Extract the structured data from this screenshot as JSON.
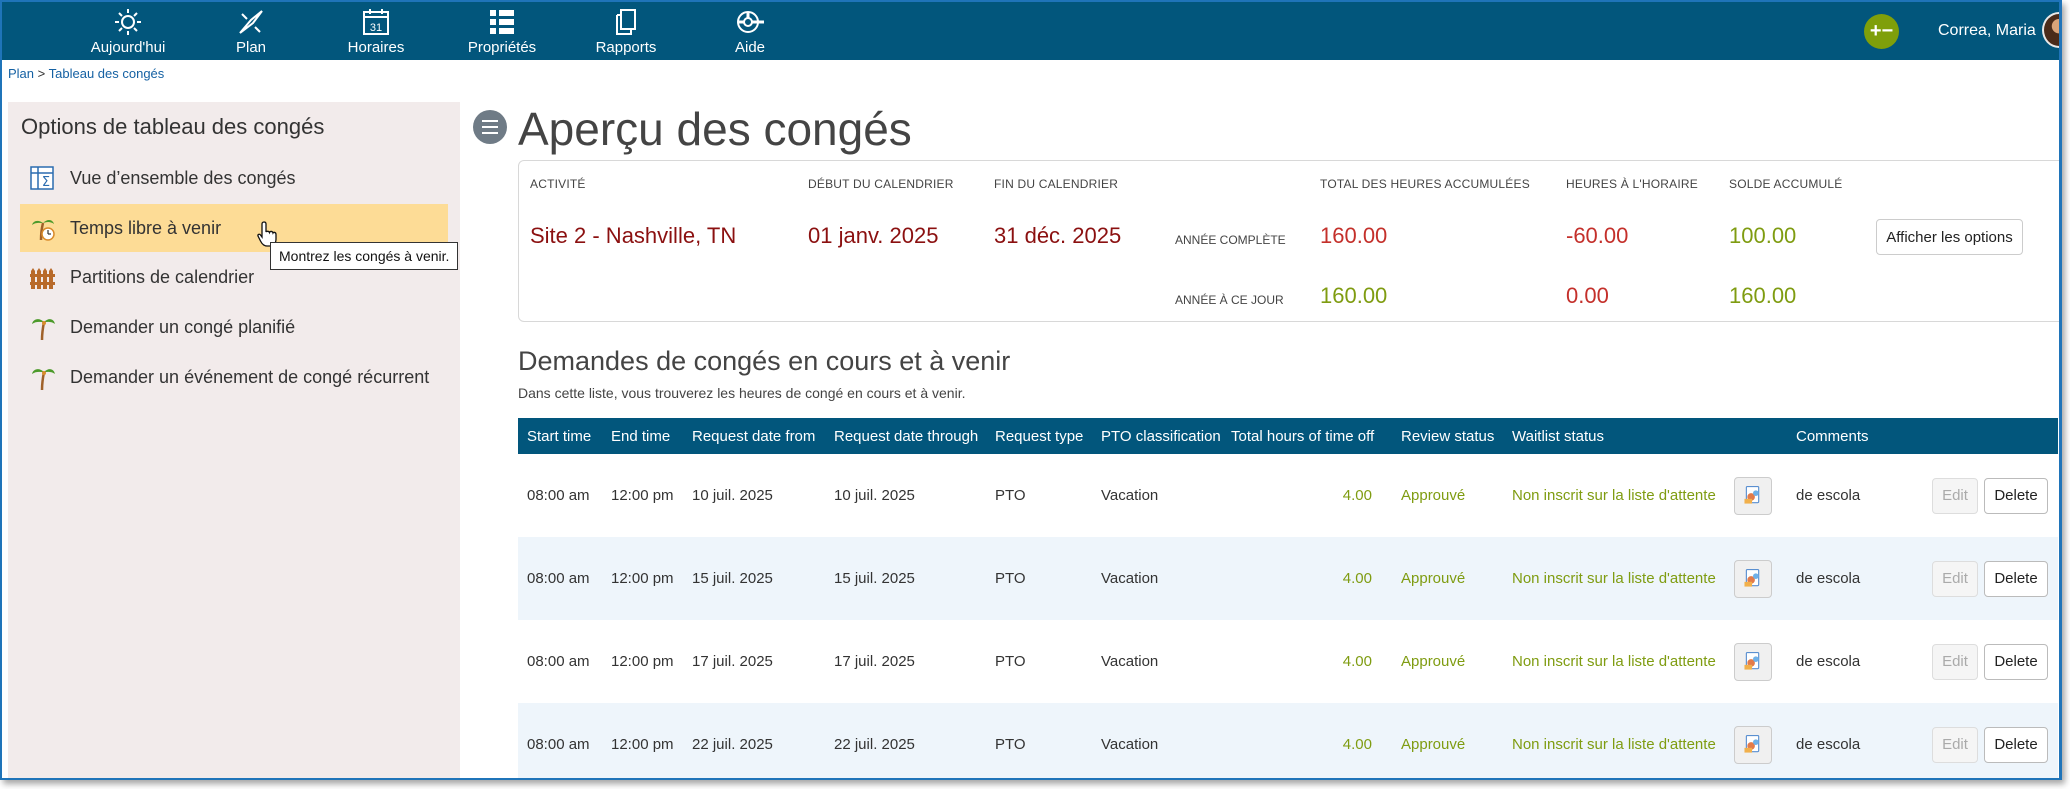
{
  "nav": {
    "items": [
      {
        "label": "Aujourd'hui",
        "icon": "sun-icon"
      },
      {
        "label": "Plan",
        "icon": "compass-icon"
      },
      {
        "label": "Horaires",
        "icon": "calendar-icon",
        "calendar_day": "31"
      },
      {
        "label": "Propriétés",
        "icon": "list-icon"
      },
      {
        "label": "Rapports",
        "icon": "documents-icon"
      },
      {
        "label": "Aide",
        "icon": "life-ring-icon"
      }
    ],
    "add_glyph": "+−",
    "user_name": "Correa, Maria"
  },
  "breadcrumb": {
    "root": "Plan",
    "separator": ">",
    "current": "Tableau des congés"
  },
  "sidebar": {
    "title": "Options de tableau des congés",
    "items": [
      {
        "label": "Vue d’ensemble des congés",
        "icon": "spreadsheet-sum-icon",
        "active": false
      },
      {
        "label": "Temps libre à venir",
        "icon": "palm-clock-icon",
        "active": true
      },
      {
        "label": "Partitions de calendrier",
        "icon": "fence-icon",
        "active": false
      },
      {
        "label": "Demander un congé planifié",
        "icon": "palm-tree-icon",
        "active": false
      },
      {
        "label": "Demander un événement de congé récurrent",
        "icon": "palm-tree-icon",
        "active": false
      }
    ]
  },
  "tooltip": "Montrez les congés à venir.",
  "main": {
    "title": "Aperçu des congés",
    "summary": {
      "headers": {
        "activity": "ACTIVITÉ",
        "calendar_start": "DÉBUT DU CALENDRIER",
        "calendar_end": "FIN DU CALENDRIER",
        "total_accrued": "TOTAL DES HEURES ACCUMULÉES",
        "scheduled_hours": "HEURES À L'HORAIRE",
        "accrued_balance": "SOLDE ACCUMULÉ"
      },
      "activity": "Site 2 - Nashville, TN",
      "calendar_start": "01 janv. 2025",
      "calendar_end": "31 déc. 2025",
      "rows": [
        {
          "label": "ANNÉE COMPLÈTE",
          "total_accrued": "160.00",
          "scheduled_hours": "-60.00",
          "accrued_balance": "100.00"
        },
        {
          "label": "ANNÉE À CE JOUR",
          "total_accrued": "160.00",
          "scheduled_hours": "0.00",
          "accrued_balance": "160.00"
        }
      ],
      "show_options_label": "Afficher les options"
    },
    "section_title": "Demandes de congés en cours et à venir",
    "section_desc": "Dans cette liste, vous trouverez les heures de congé en cours et à venir.",
    "table": {
      "columns": [
        "Start time",
        "End time",
        "Request date from",
        "Request date through",
        "Request type",
        "PTO classification",
        "Total hours of time off",
        "Review status",
        "Waitlist status",
        "",
        "Comments",
        ""
      ],
      "edit_label": "Edit",
      "delete_label": "Delete",
      "rows": [
        {
          "start": "08:00 am",
          "end": "12:00 pm",
          "from": "10 juil. 2025",
          "through": "10 juil. 2025",
          "type": "PTO",
          "classification": "Vacation",
          "hours": "4.00",
          "review": "Approuvé",
          "waitlist": "Non inscrit sur la liste d'attente",
          "comments": "de escola"
        },
        {
          "start": "08:00 am",
          "end": "12:00 pm",
          "from": "15 juil. 2025",
          "through": "15 juil. 2025",
          "type": "PTO",
          "classification": "Vacation",
          "hours": "4.00",
          "review": "Approuvé",
          "waitlist": "Non inscrit sur la liste d'attente",
          "comments": "de escola"
        },
        {
          "start": "08:00 am",
          "end": "12:00 pm",
          "from": "17 juil. 2025",
          "through": "17 juil. 2025",
          "type": "PTO",
          "classification": "Vacation",
          "hours": "4.00",
          "review": "Approuvé",
          "waitlist": "Non inscrit sur la liste d'attente",
          "comments": "de escola"
        },
        {
          "start": "08:00 am",
          "end": "12:00 pm",
          "from": "22 juil. 2025",
          "through": "22 juil. 2025",
          "type": "PTO",
          "classification": "Vacation",
          "hours": "4.00",
          "review": "Approuvé",
          "waitlist": "Non inscrit sur la liste d'attente",
          "comments": "de escola"
        }
      ]
    }
  },
  "colors": {
    "nav_bg": "#02567c",
    "sidebar_bg": "#f2ebeb",
    "active_item_bg": "#fddc96",
    "value_dark_red": "#8b1010",
    "value_red": "#c4302b",
    "value_green": "#7f9c11"
  }
}
